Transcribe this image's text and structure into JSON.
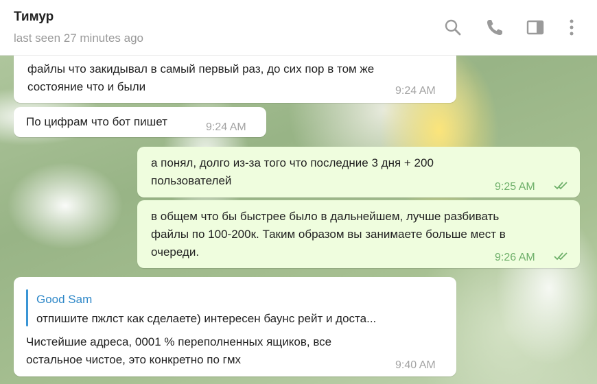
{
  "header": {
    "title": "Тимур",
    "status": "last seen 27 minutes ago",
    "icons": [
      "search-icon",
      "phone-icon",
      "sidebar-icon",
      "more-icon"
    ]
  },
  "messages": [
    {
      "direction": "in",
      "lines": [
        "файлы что закидывал в самый первый раз, до сих пор в том же",
        "состояние что и были"
      ],
      "time": "9:24 AM"
    },
    {
      "direction": "in",
      "lines": [
        "По цифрам что бот пишет"
      ],
      "time": "9:24 AM"
    },
    {
      "direction": "out",
      "lines": [
        "а понял, долго из-за того что последние 3 дня + 200",
        "пользователей"
      ],
      "time": "9:25 AM",
      "read": true
    },
    {
      "direction": "out",
      "lines": [
        "в общем что бы быстрее было в дальнейшем, лучше разбивать",
        "файлы по 100-200к. Таким образом вы занимаете больше мест в",
        "очереди."
      ],
      "time": "9:26 AM",
      "read": true
    },
    {
      "direction": "in",
      "reply": {
        "name": "Good Sam",
        "text": "отпишите пжлст как сделаете) интересен баунс рейт и доста..."
      },
      "lines": [
        "Чистейшие адреса, 0001 % переполненных ящиков, все",
        "остальное чистое, это конкретно по гмх"
      ],
      "time": "9:40 AM"
    }
  ],
  "colors": {
    "incoming_bubble": "#ffffff",
    "outgoing_bubble": "#effdde",
    "outgoing_time": "#6fb06a",
    "reply_accent": "#3a95d5"
  }
}
